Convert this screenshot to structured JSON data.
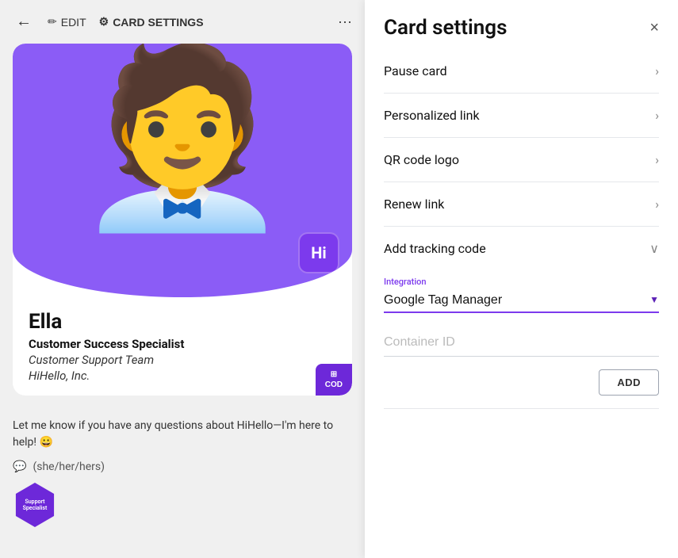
{
  "topbar": {
    "back_icon": "←",
    "edit_label": "EDIT",
    "edit_icon": "✏",
    "card_settings_label": "CARD SETTINGS",
    "card_settings_icon": "⚙",
    "more_icon": "···"
  },
  "card": {
    "name": "Ella",
    "title": "Customer Success Specialist",
    "team": "Customer Support Team",
    "company": "HiHello, Inc.",
    "bio": "Let me know if you have any questions about HiHello—I'm here to help! 😀",
    "pronouns": "(she/her/hers)",
    "hi_badge": "Hi",
    "qr_label": "COD"
  },
  "right_panel": {
    "close_icon": "×",
    "title": "Card settings",
    "settings_items": [
      {
        "label": "Pause card",
        "expanded": false
      },
      {
        "label": "Personalized link",
        "expanded": false
      },
      {
        "label": "QR code logo",
        "expanded": false
      },
      {
        "label": "Renew link",
        "expanded": false
      },
      {
        "label": "Add tracking code",
        "expanded": true
      }
    ],
    "tracking": {
      "integration_label": "Integration",
      "integration_value": "Google Tag Manager",
      "container_label": "Container ID",
      "container_placeholder": "Container ID",
      "add_button": "ADD"
    }
  }
}
